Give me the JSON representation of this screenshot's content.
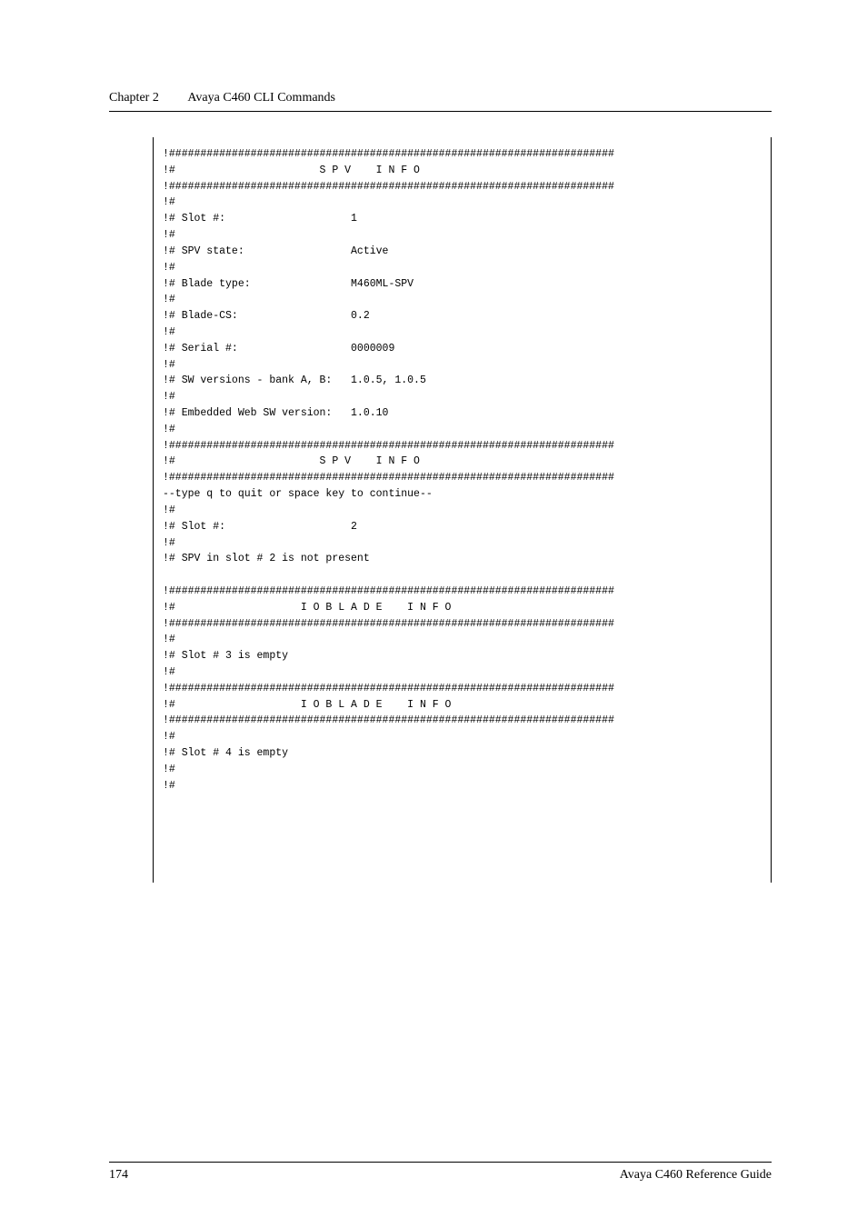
{
  "header": {
    "chapter_label": "Chapter 2",
    "chapter_title": "Avaya C460 CLI Commands"
  },
  "code": {
    "lines": [
      "!#######################################################################",
      "!#                       S P V    I N F O",
      "!#######################################################################",
      "!#",
      "!# Slot #:                    1",
      "!#",
      "!# SPV state:                 Active",
      "!#",
      "!# Blade type:                M460ML-SPV",
      "!#",
      "!# Blade-CS:                  0.2",
      "!#",
      "!# Serial #:                  0000009",
      "!#",
      "!# SW versions - bank A, B:   1.0.5, 1.0.5",
      "!#",
      "!# Embedded Web SW version:   1.0.10",
      "!#",
      "!#######################################################################",
      "!#                       S P V    I N F O",
      "!#######################################################################",
      "--type q to quit or space key to continue--",
      "!#",
      "!# Slot #:                    2",
      "!#",
      "!# SPV in slot # 2 is not present",
      "",
      "!#######################################################################",
      "!#                    I O B L A D E    I N F O",
      "!#######################################################################",
      "!#",
      "!# Slot # 3 is empty",
      "!#",
      "!#######################################################################",
      "!#                    I O B L A D E    I N F O",
      "!#######################################################################",
      "!#",
      "!# Slot # 4 is empty",
      "!#",
      "!#"
    ]
  },
  "footer": {
    "page_number": "174",
    "book_title": "Avaya C460 Reference Guide"
  }
}
